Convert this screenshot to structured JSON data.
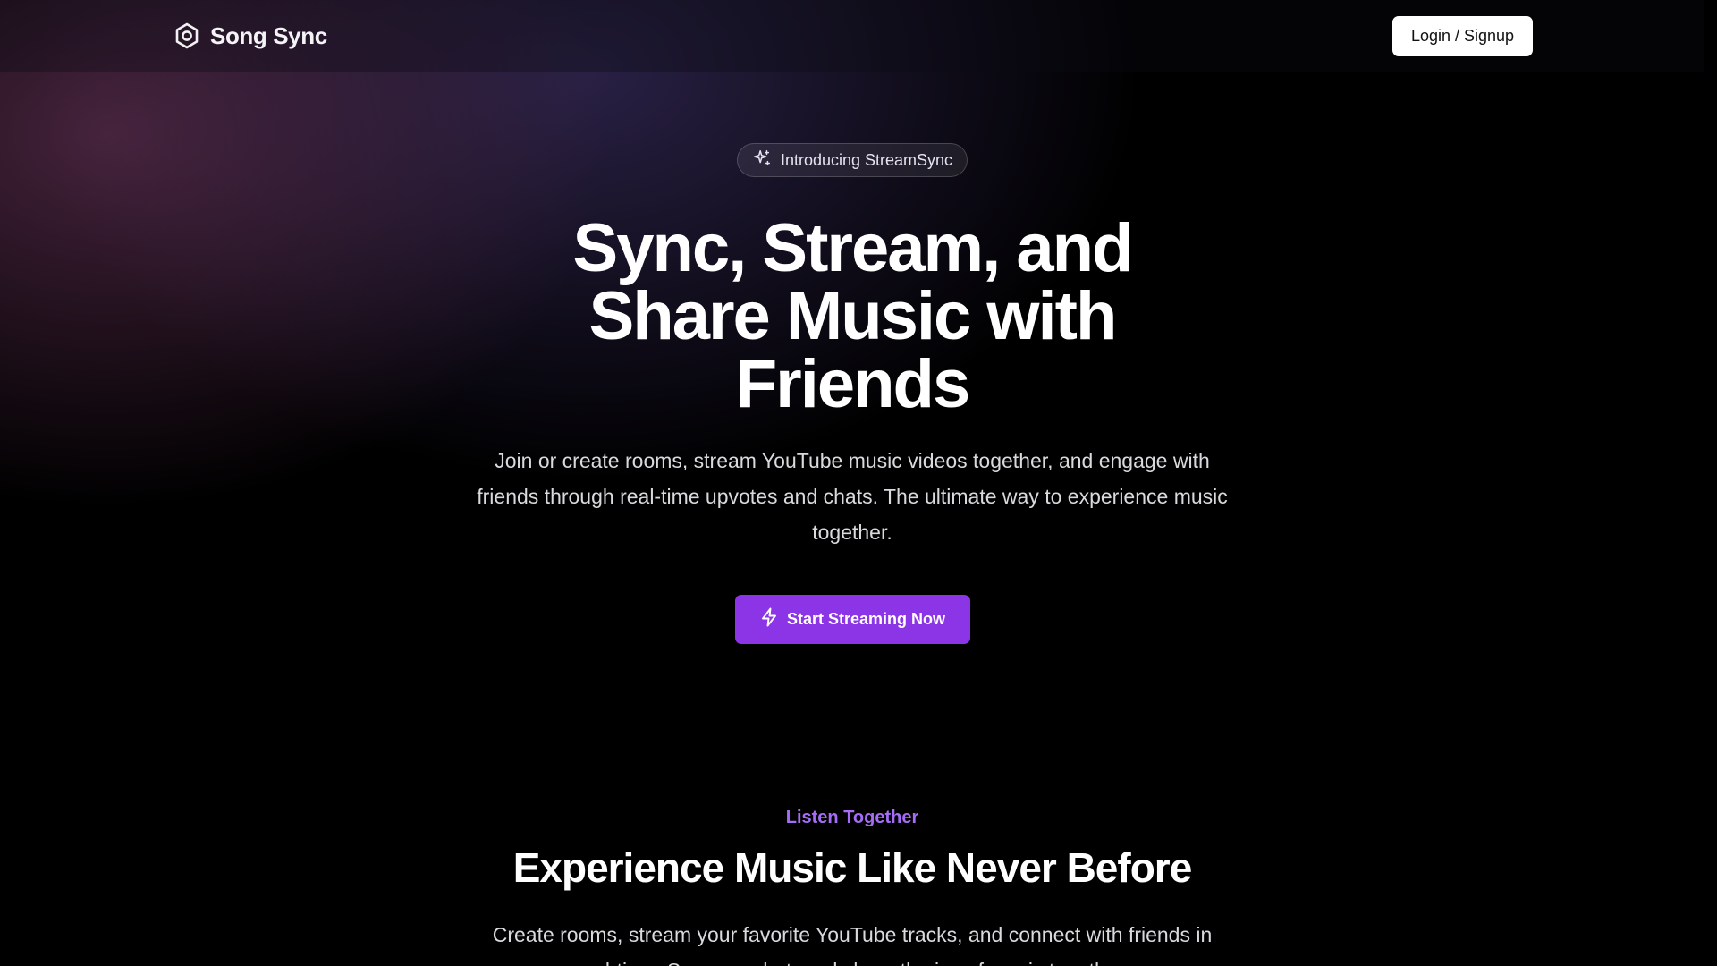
{
  "header": {
    "brand_name": "Song Sync",
    "brand_icon": "hexagon-nut-icon",
    "login_label": "Login / Signup"
  },
  "hero": {
    "badge_icon": "sparkles-icon",
    "badge_label": "Introducing StreamSync",
    "title": "Sync, Stream, and Share Music with Friends",
    "subtitle": "Join or create rooms, stream YouTube music videos together, and engage with friends through real-time upvotes and chats. The ultimate way to experience music together.",
    "cta_icon": "lightning-bolt-icon",
    "cta_label": "Start Streaming Now"
  },
  "features": {
    "eyebrow": "Listen Together",
    "title": "Experience Music Like Never Before",
    "subtitle": "Create rooms, stream your favorite YouTube tracks, and connect with friends in real-time. Sync up, chat, and share the joy of music together."
  },
  "colors": {
    "accent": "#8b35e6",
    "eyebrow": "#a66cf7",
    "background": "#000000",
    "text": "#ffffff"
  }
}
